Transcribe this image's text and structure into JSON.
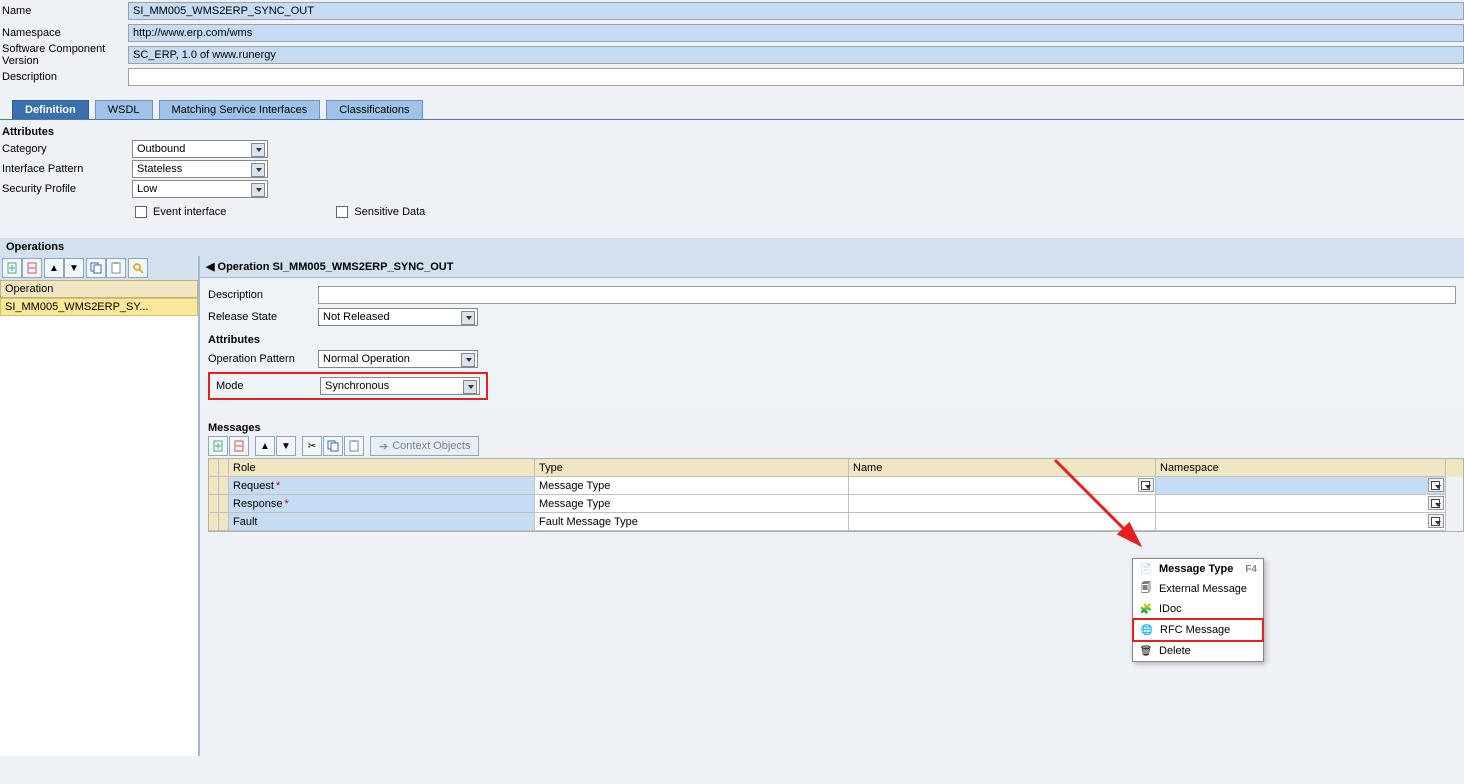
{
  "header": {
    "name_lbl": "Name",
    "name_val": "SI_MM005_WMS2ERP_SYNC_OUT",
    "ns_lbl": "Namespace",
    "ns_val": "http://www.erp.com/wms",
    "swcv_lbl": "Software Component Version",
    "swcv_val": "SC_ERP, 1.0 of www.runergy",
    "desc_lbl": "Description",
    "desc_val": ""
  },
  "tabs": {
    "def": "Definition",
    "wsdl": "WSDL",
    "msi": "Matching Service Interfaces",
    "cls": "Classifications"
  },
  "attrs": {
    "title": "Attributes",
    "cat_lbl": "Category",
    "cat_val": "Outbound",
    "ip_lbl": "Interface Pattern",
    "ip_val": "Stateless",
    "sp_lbl": "Security Profile",
    "sp_val": "Low",
    "evt": "Event interface",
    "sens": "Sensitive Data"
  },
  "ops": {
    "band": "Operations",
    "col_hdr": "Operation",
    "item": "SI_MM005_WMS2ERP_SY...",
    "title": "Operation SI_MM005_WMS2ERP_SYNC_OUT",
    "desc_lbl": "Description",
    "desc_val": "",
    "rel_lbl": "Release State",
    "rel_val": "Not Released"
  },
  "opattrs": {
    "title": "Attributes",
    "pat_lbl": "Operation Pattern",
    "pat_val": "Normal Operation",
    "mode_lbl": "Mode",
    "mode_val": "Synchronous"
  },
  "msgs": {
    "title": "Messages",
    "ctx_btn": "Context Objects",
    "cols": {
      "role": "Role",
      "type": "Type",
      "name": "Name",
      "ns": "Namespace"
    },
    "rows": [
      {
        "role": "Request",
        "req": true,
        "type": "Message Type",
        "name": "",
        "ns": ""
      },
      {
        "role": "Response",
        "req": true,
        "type": "Message Type",
        "name": "",
        "ns": ""
      },
      {
        "role": "Fault",
        "req": false,
        "type": "Fault Message Type",
        "name": "",
        "ns": ""
      }
    ],
    "menu": {
      "mt": "Message Type",
      "mt_help": "F4",
      "ext": "External Message",
      "idoc": "IDoc",
      "rfc": "RFC Message",
      "del": "Delete"
    }
  }
}
